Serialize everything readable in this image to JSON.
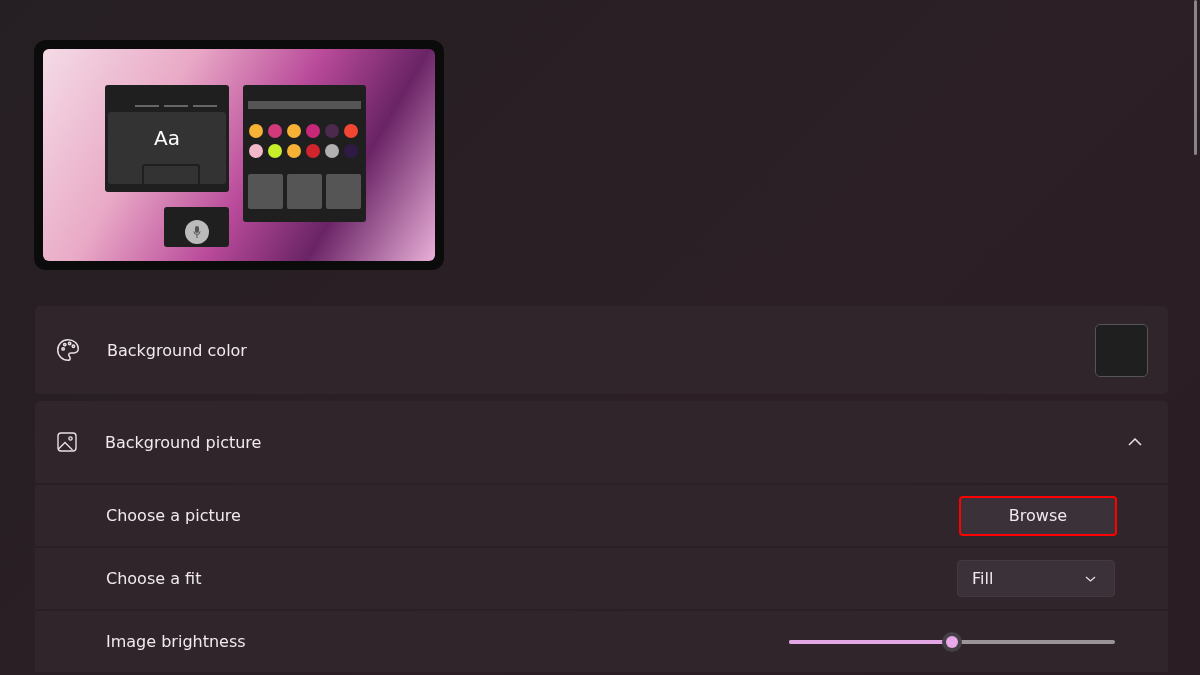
{
  "preview": {
    "sample_text": "Aa"
  },
  "background_color": {
    "label": "Background color"
  },
  "background_picture": {
    "label": "Background picture",
    "expanded": true,
    "rows": [
      {
        "kind": "button",
        "label": "Choose a picture",
        "button": "Browse",
        "highlighted": true
      },
      {
        "kind": "dropdown",
        "label": "Choose a fit",
        "value": "Fill"
      },
      {
        "kind": "slider",
        "label": "Image brightness",
        "level": 0.5
      }
    ]
  }
}
